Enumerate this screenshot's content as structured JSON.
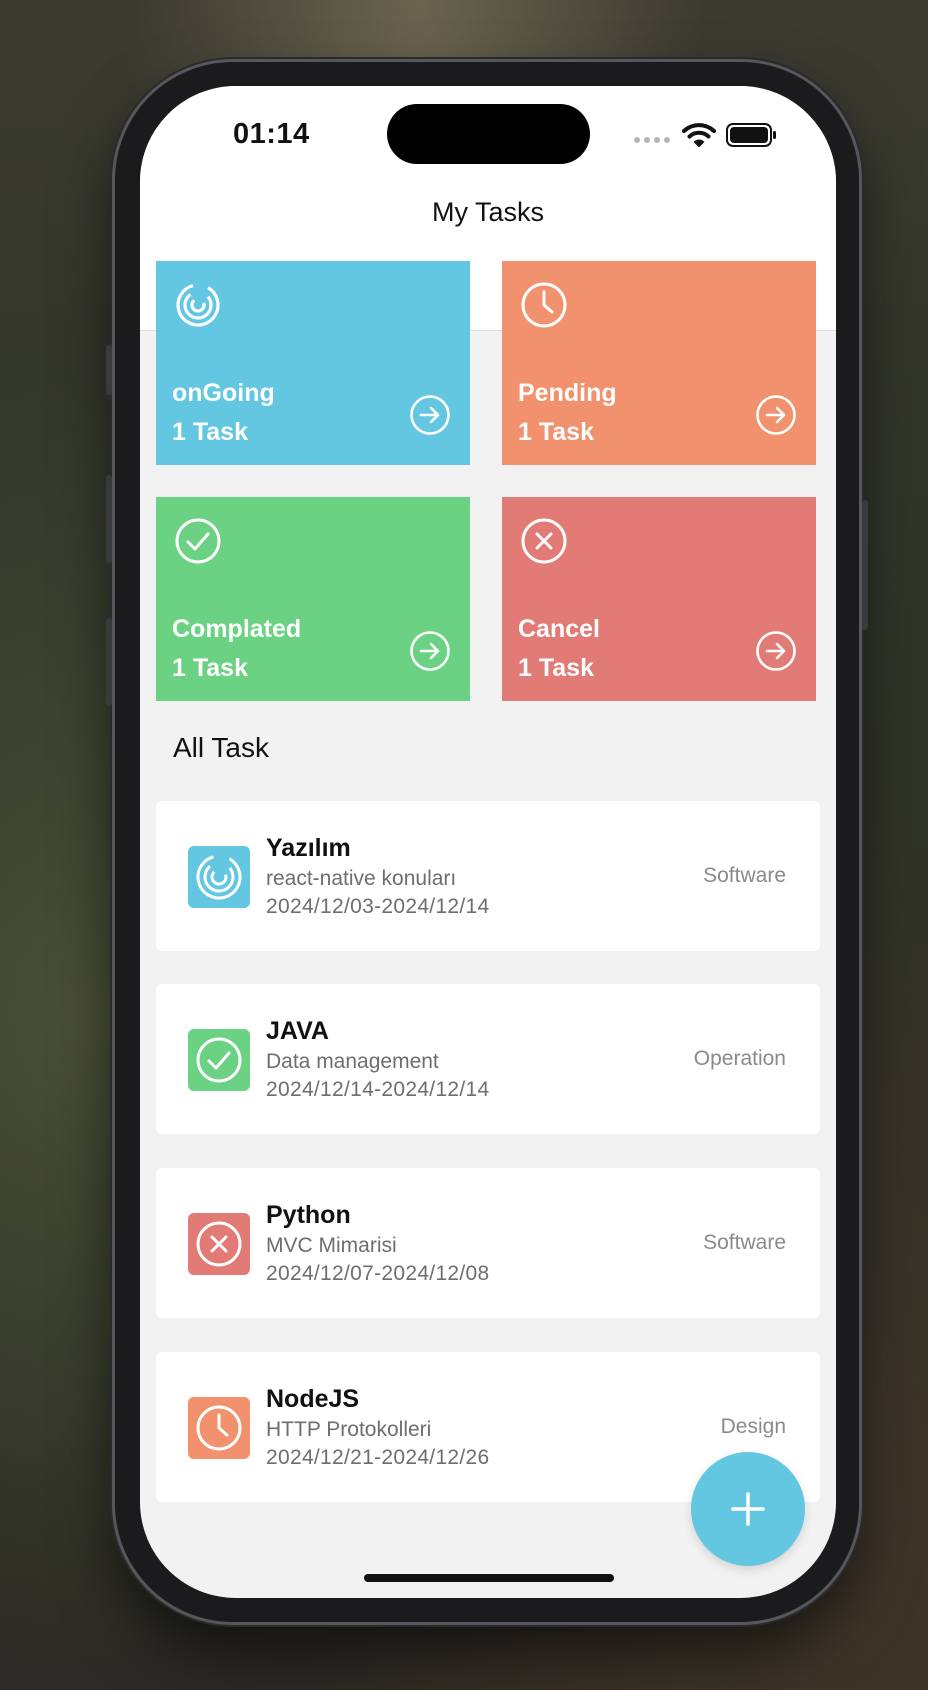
{
  "status_bar": {
    "time": "01:14"
  },
  "header": {
    "title": "My Tasks"
  },
  "summary_tiles": [
    {
      "label": "onGoing",
      "count": "1 Task",
      "color": "#63c7e2",
      "icon": "spinner-icon"
    },
    {
      "label": "Pending",
      "count": "1 Task",
      "color": "#f2916d",
      "icon": "clock-icon"
    },
    {
      "label": "Complated",
      "count": "1 Task",
      "color": "#6cd283",
      "icon": "check-circle-icon"
    },
    {
      "label": "Cancel",
      "count": "1 Task",
      "color": "#e27a76",
      "icon": "x-circle-icon"
    }
  ],
  "all_tasks": {
    "title": "All Task",
    "items": [
      {
        "title": "Yazılım",
        "description": "react-native konuları",
        "dates": "2024/12/03-2024/12/14",
        "category": "Software",
        "status_icon": "spinner-icon",
        "color": "#63c7e2"
      },
      {
        "title": "JAVA",
        "description": "Data management",
        "dates": "2024/12/14-2024/12/14",
        "category": "Operation",
        "status_icon": "check-circle-icon",
        "color": "#6cd283"
      },
      {
        "title": "Python",
        "description": "MVC Mimarisi",
        "dates": "2024/12/07-2024/12/08",
        "category": "Software",
        "status_icon": "x-circle-icon",
        "color": "#e27a76"
      },
      {
        "title": "NodeJS",
        "description": "HTTP Protokolleri",
        "dates": "2024/12/21-2024/12/26",
        "category": "Design",
        "status_icon": "clock-icon",
        "color": "#f2916d"
      }
    ]
  },
  "fab": {
    "icon": "plus-icon",
    "color": "#63c7e2"
  }
}
